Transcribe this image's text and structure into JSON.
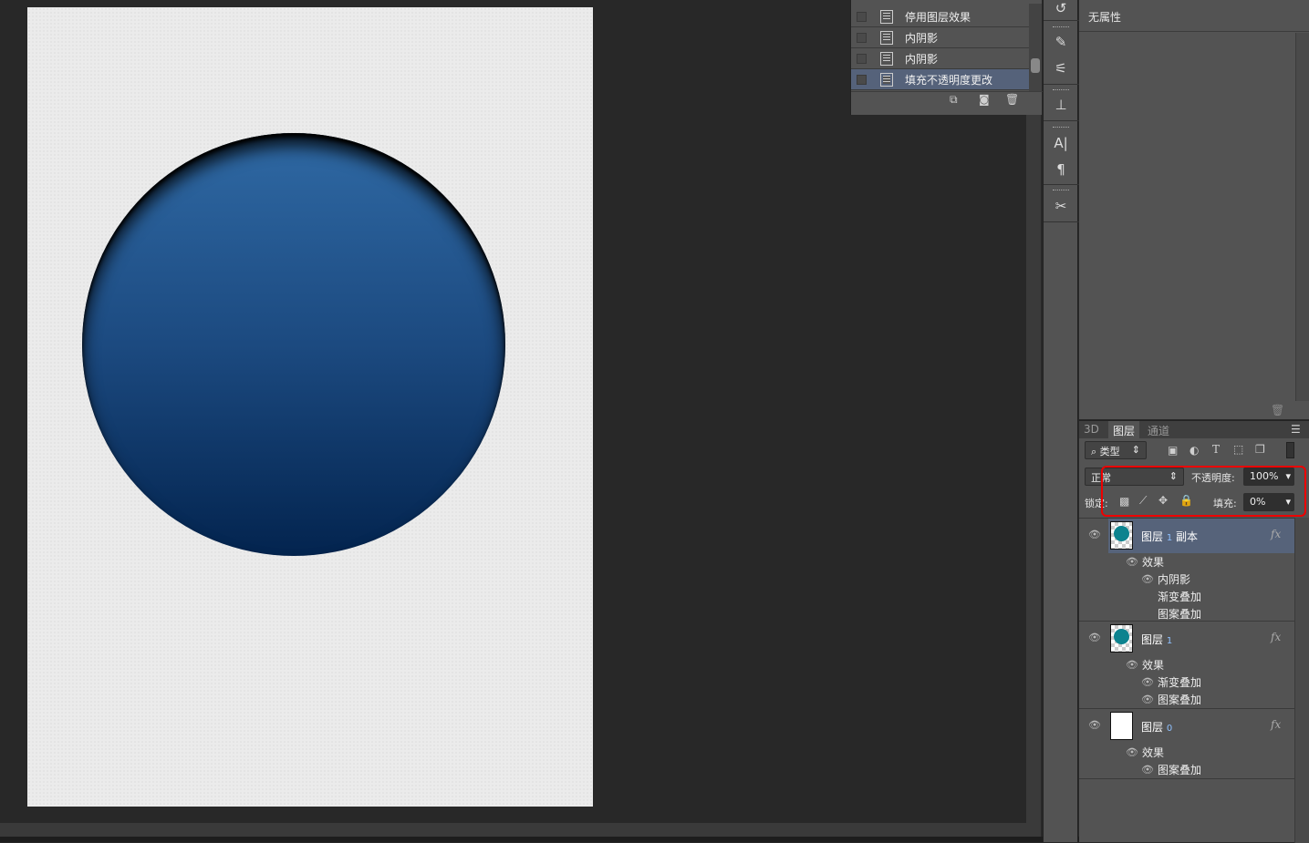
{
  "history": {
    "items": [
      {
        "label": "停用图层效果",
        "selected": false
      },
      {
        "label": "内阴影",
        "selected": false
      },
      {
        "label": "内阴影",
        "selected": false
      },
      {
        "label": "填充不透明度更改",
        "selected": true
      }
    ]
  },
  "properties": {
    "title": "无属性"
  },
  "layers_panel": {
    "tabs": [
      "3D",
      "图层",
      "通道"
    ],
    "active_tab": "图层",
    "filter_label": "类型",
    "blend_mode": "正常",
    "opacity_label": "不透明度:",
    "opacity_value": "100%",
    "lock_label": "锁定:",
    "fill_label": "填充:",
    "fill_value": "0%",
    "layers": [
      {
        "name": "图层",
        "num": "1",
        "suffix": "副本",
        "effects_label": "效果",
        "effects": [
          "内阴影",
          "渐变叠加",
          "图案叠加"
        ]
      },
      {
        "name": "图层",
        "num": "1",
        "suffix": "",
        "effects_label": "效果",
        "effects": [
          "渐变叠加",
          "图案叠加"
        ]
      },
      {
        "name": "图层",
        "num": "0",
        "suffix": "",
        "effects_label": "效果",
        "effects": [
          "图案叠加"
        ]
      }
    ],
    "fx_label": "fx"
  },
  "colors": {
    "highlight": "#e00000",
    "circle_top": "#2f69a4",
    "circle_bottom": "#03244f"
  }
}
